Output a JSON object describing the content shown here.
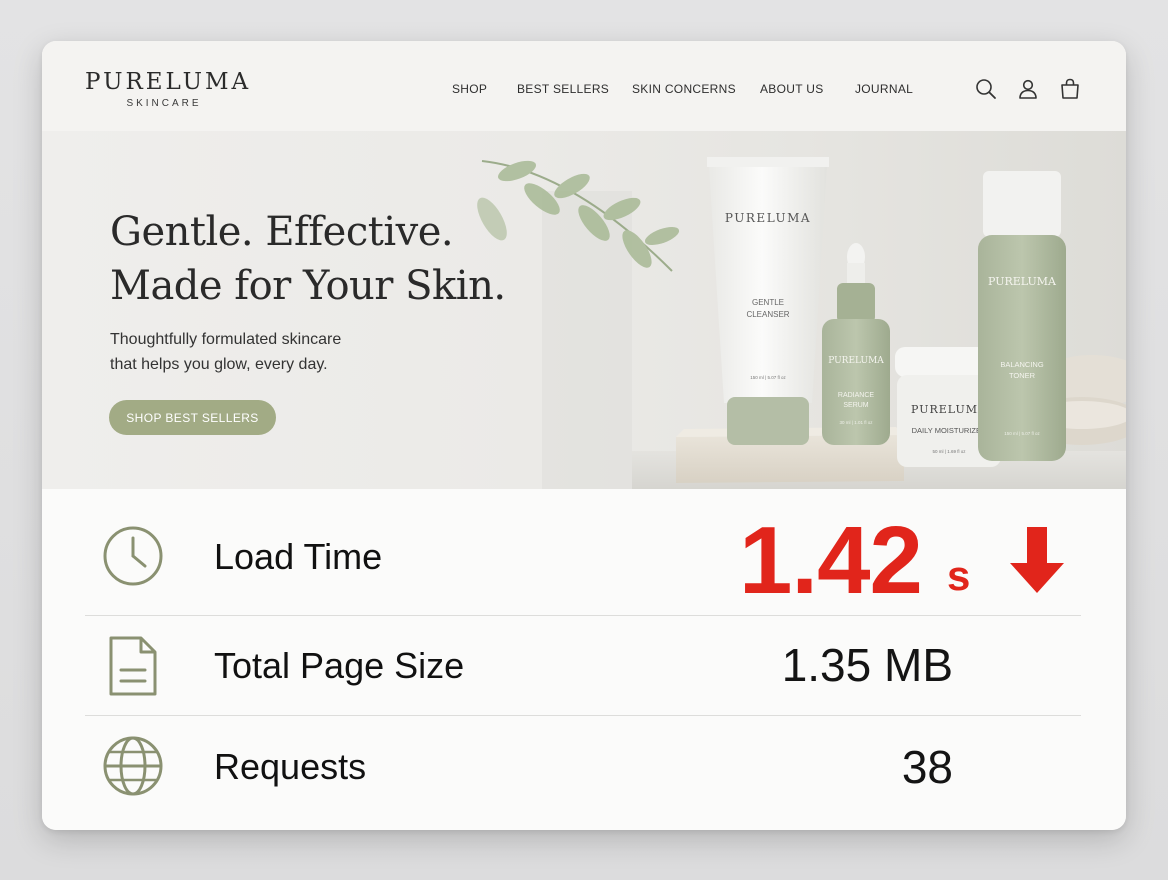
{
  "brand": {
    "name": "PURELUMA",
    "tagline": "SKINCARE"
  },
  "nav": {
    "items": [
      {
        "label": "SHOP"
      },
      {
        "label": "BEST SELLERS"
      },
      {
        "label": "SKIN CONCERNS"
      },
      {
        "label": "ABOUT US"
      },
      {
        "label": "JOURNAL"
      }
    ],
    "icons": [
      "search-icon",
      "account-icon",
      "shopping-bag-icon"
    ]
  },
  "hero": {
    "title_line1": "Gentle. Effective.",
    "title_line2": "Made for Your Skin.",
    "subtitle_line1": "Thoughtfully formulated skincare",
    "subtitle_line2": "that helps you glow, every day.",
    "cta": "SHOP BEST SELLERS",
    "products": {
      "cleanser": {
        "brand": "PURELUMA",
        "name_line1": "GENTLE",
        "name_line2": "CLEANSER",
        "size": "150 ml | 5.07 fl oz"
      },
      "serum": {
        "brand": "PURELUMA",
        "name_line1": "RADIANCE",
        "name_line2": "SERUM",
        "size": "30 ml | 1.01 fl oz"
      },
      "moisturizer": {
        "brand": "PURELUMA",
        "name": "DAILY MOISTURIZER",
        "size": "50 ml | 1.69 fl oz"
      },
      "toner": {
        "brand": "PURELUMA",
        "name_line1": "BALANCING",
        "name_line2": "TONER",
        "size": "150 ml | 5.07 fl oz"
      }
    }
  },
  "metrics": {
    "load_time": {
      "label": "Load Time",
      "value": "1.42",
      "unit": "s",
      "icon": "clock-icon",
      "trend": "down"
    },
    "page_size": {
      "label": "Total Page Size",
      "value": "1.35 MB",
      "icon": "document-icon"
    },
    "requests": {
      "label": "Requests",
      "value": "38",
      "icon": "globe-icon"
    }
  },
  "colors": {
    "accent_sage": "#a2ab85",
    "alert_red": "#e1251b",
    "text_dark": "#2a2a2a"
  }
}
